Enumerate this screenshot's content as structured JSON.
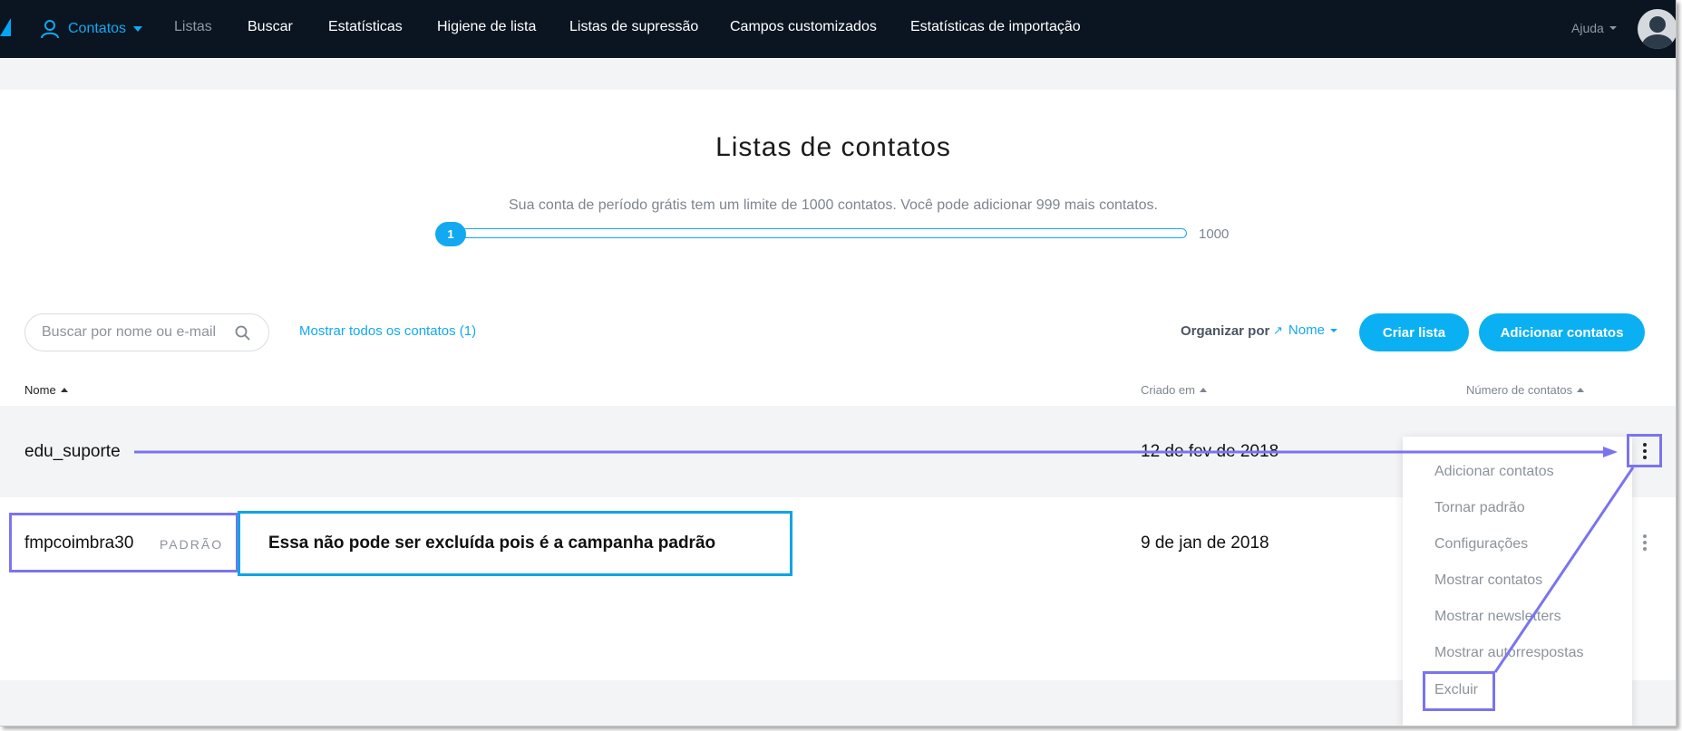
{
  "nav": {
    "active_label": "Contatos",
    "items": [
      "Listas",
      "Buscar",
      "Estatísticas",
      "Higiene de lista",
      "Listas de supressão",
      "Campos customizados",
      "Estatísticas de importação"
    ],
    "help_label": "Ajuda"
  },
  "header": {
    "title": "Listas de contatos",
    "limit_text": "Sua conta de período grátis tem um limite de 1000 contatos. Você pode adicionar 999 mais contatos."
  },
  "progress": {
    "current_label": "1",
    "max_label": "1000",
    "current": 1,
    "max": 1000
  },
  "toolbar": {
    "search_placeholder": "Buscar por nome ou e-mail",
    "show_all_label": "Mostrar todos os contatos (1)",
    "sort_label": "Organizar por",
    "sort_value": "Nome",
    "create_list_label": "Criar lista",
    "add_contacts_label": "Adicionar contatos"
  },
  "table": {
    "columns": [
      "Nome",
      "Criado em",
      "Número de contatos"
    ],
    "rows": [
      {
        "name": "edu_suporte",
        "created": "12 de fev de 2018",
        "badge": ""
      },
      {
        "name": "fmpcoimbra30",
        "created": "9 de jan de 2018",
        "badge": "PADRÃO"
      }
    ]
  },
  "menu": {
    "items": [
      "Adicionar contatos",
      "Tornar padrão",
      "Configurações",
      "Mostrar contatos",
      "Mostrar newsletters",
      "Mostrar autorrespostas",
      "Excluir"
    ]
  },
  "annotation": {
    "note": "Essa não pode ser excluída pois é a campanha padrão"
  },
  "colors": {
    "nav_bg": "#0b1521",
    "accent": "#0ab0f2",
    "annotation_purple": "#7b74ee",
    "annotation_blue": "#0ea5e5"
  }
}
